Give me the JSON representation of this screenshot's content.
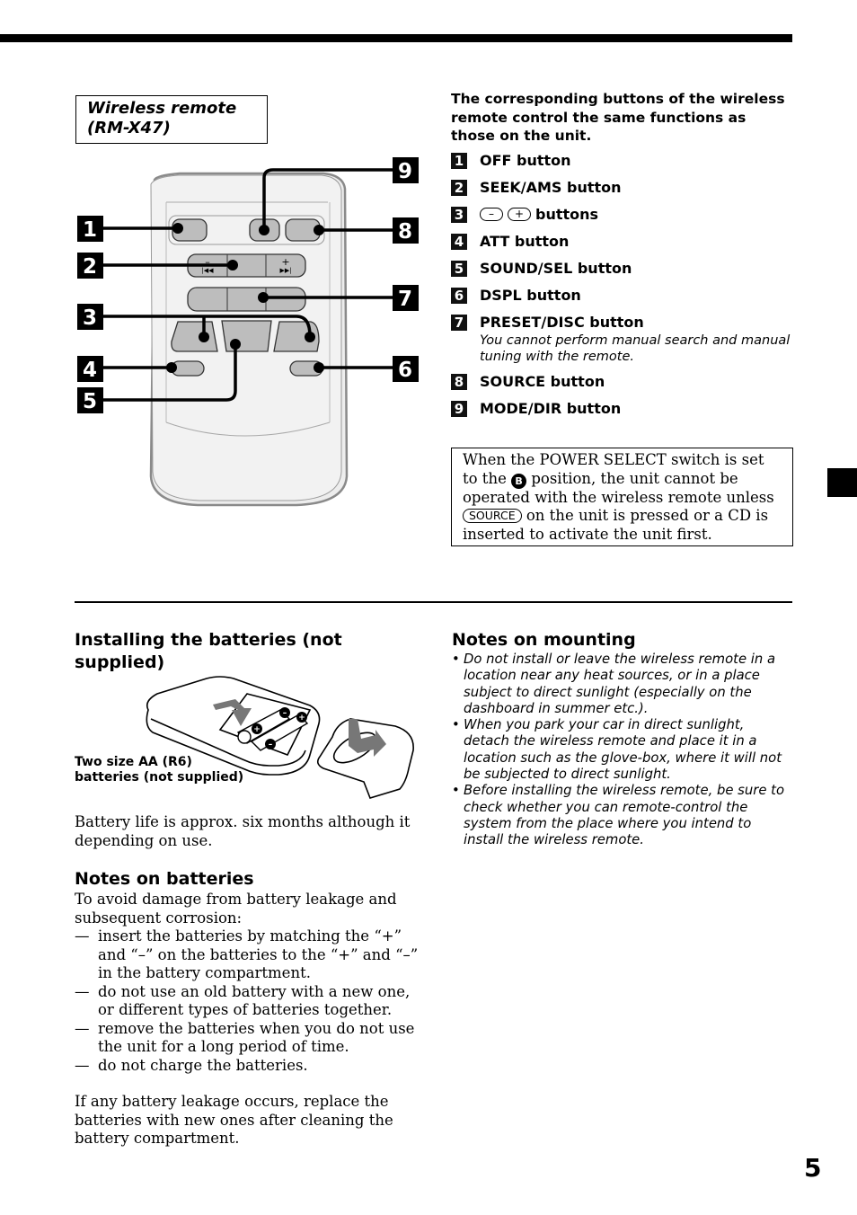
{
  "header": {
    "page_number": "5"
  },
  "remote_figure": {
    "title_line1": "Wireless remote",
    "title_line2": "(RM-X47)",
    "callouts": [
      "1",
      "2",
      "3",
      "4",
      "5",
      "6",
      "7",
      "8",
      "9"
    ],
    "seek_minus": "–",
    "seek_plus": "+"
  },
  "buttons_section": {
    "intro": "The corresponding buttons of the wireless remote control the same functions as those on the unit.",
    "items": [
      {
        "num": "1",
        "label": "OFF button"
      },
      {
        "num": "2",
        "label": "SEEK/AMS button"
      },
      {
        "num": "3",
        "label": "buttons",
        "minus_key": "–",
        "plus_key": "+"
      },
      {
        "num": "4",
        "label": "ATT button"
      },
      {
        "num": "5",
        "label": "SOUND/SEL button"
      },
      {
        "num": "6",
        "label": "DSPL button"
      },
      {
        "num": "7",
        "label": "PRESET/DISC button",
        "note": "You cannot perform manual search and manual tuning with the remote."
      },
      {
        "num": "8",
        "label": "SOURCE button"
      },
      {
        "num": "9",
        "label": "MODE/DIR button"
      }
    ]
  },
  "notice": {
    "part1": "When the POWER SELECT switch is set to the",
    "badge": "B",
    "part2": "position, the unit cannot be operated with the wireless remote unless",
    "source_key": "SOURCE",
    "part3": "on the unit is pressed or a CD is inserted to activate the unit first."
  },
  "installing": {
    "title": "Installing the batteries (not supplied)",
    "caption_line1": "Two size AA (R6)",
    "caption_line2": "batteries (not supplied)",
    "battery_life": "Battery life is approx. six months although it depending on use."
  },
  "notes_batteries": {
    "title": "Notes on batteries",
    "intro": "To avoid damage from battery leakage and subsequent corrosion:",
    "dash": "—",
    "items": [
      "insert the batteries by matching the “+” and “–” on the batteries to the “+” and “–” in the battery compartment.",
      "do not use an old battery with a new one, or different types of batteries together.",
      "remove the batteries when you do not use the unit for a long period of time.",
      "do not charge the batteries."
    ],
    "closing": "If any battery leakage occurs, replace the batteries with new ones after cleaning the battery compartment."
  },
  "notes_mounting": {
    "title": "Notes on mounting",
    "bullet": "•",
    "items": [
      "Do not install or leave the wireless remote in a location near any heat sources, or in a place subject to direct sunlight (especially on the dashboard in summer etc.).",
      "When you park your car in direct sunlight, detach the wireless remote and place it in a location such as the glove-box, where it will not be subjected to direct sunlight.",
      "Before installing the wireless remote, be sure to check whether you can remote-control the system from the place where you intend to install the wireless remote."
    ]
  }
}
